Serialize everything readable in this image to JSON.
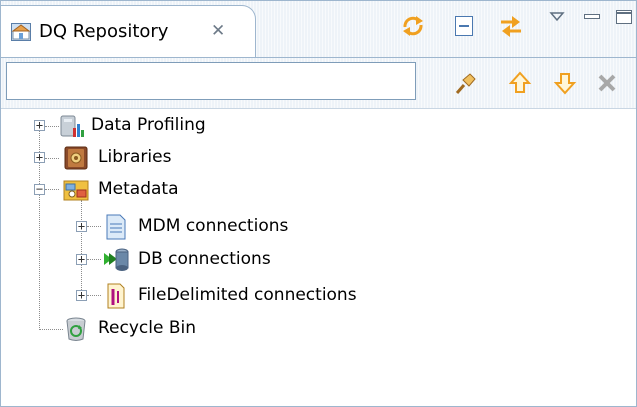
{
  "view": {
    "title": "DQ Repository",
    "close_glyph": "✕",
    "actions": [
      "sync-icon",
      "collapse-all-icon",
      "link-with-editor-icon",
      "view-menu-icon",
      "minimize-icon",
      "maximize-icon"
    ]
  },
  "toolbar": {
    "filter_value": "",
    "buttons": [
      "pin-icon",
      "move-up-icon",
      "move-down-icon",
      "delete-icon"
    ]
  },
  "tree": {
    "nodes": [
      {
        "label": "Data Profiling",
        "icon": "data-profiling-icon",
        "toggle": "+"
      },
      {
        "label": "Libraries",
        "icon": "libraries-icon",
        "toggle": "+"
      },
      {
        "label": "Metadata",
        "icon": "metadata-icon",
        "toggle": "−"
      },
      {
        "label": "MDM connections",
        "icon": "mdm-connections-icon",
        "toggle": "+"
      },
      {
        "label": "DB connections",
        "icon": "db-connections-icon",
        "toggle": "+"
      },
      {
        "label": "FileDelimited connections",
        "icon": "file-delimited-icon",
        "toggle": "+"
      },
      {
        "label": "Recycle Bin",
        "icon": "recycle-bin-icon",
        "toggle": ""
      }
    ]
  },
  "colors": {
    "border": "#9eb6ce",
    "header_bg": "#eef3f8",
    "arrow_orange": "#f0a020"
  }
}
